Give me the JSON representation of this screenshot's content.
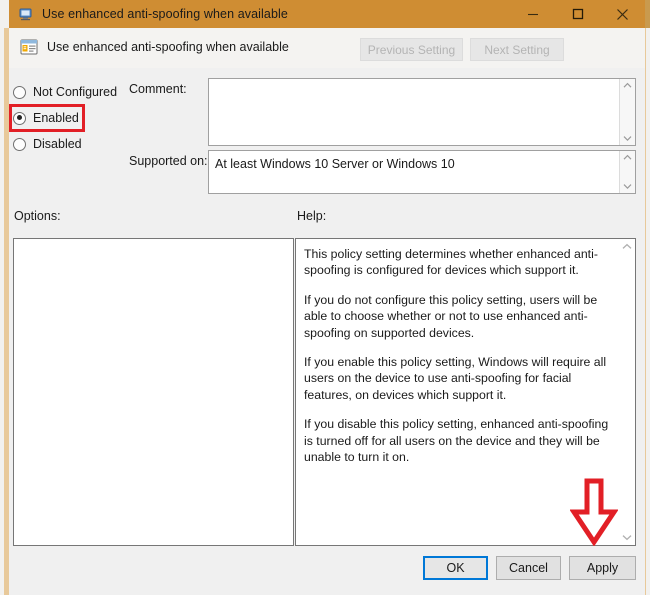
{
  "window": {
    "title": "Use enhanced anti-spoofing when available",
    "title_icon": "policy-window-icon",
    "minimize_icon": "minimize-icon",
    "maximize_icon": "maximize-icon",
    "close_icon": "close-icon",
    "titlebar_color": "#cf8d33"
  },
  "header": {
    "icon": "group-policy-setting-icon",
    "title": "Use enhanced anti-spoofing when available",
    "previous_setting_label": "Previous Setting",
    "next_setting_label": "Next Setting",
    "previous_setting_enabled": "false",
    "next_setting_enabled": "false"
  },
  "state_options": {
    "selected": "Enabled",
    "highlight_color": "#e21f26",
    "items": [
      {
        "label": "Not Configured",
        "selected": false
      },
      {
        "label": "Enabled",
        "selected": true
      },
      {
        "label": "Disabled",
        "selected": false
      }
    ]
  },
  "fields": {
    "comment_label": "Comment:",
    "comment_value": "",
    "supported_label": "Supported on:",
    "supported_value": "At least Windows 10 Server or Windows 10"
  },
  "panels": {
    "options_label": "Options:",
    "options_content": "",
    "help_label": "Help:",
    "help_paragraphs": [
      "This policy setting determines whether enhanced anti-spoofing is configured for devices which support it.",
      "If you do not configure this policy setting, users will be able to choose whether or not to use enhanced anti-spoofing on supported devices.",
      "If you enable this policy setting, Windows will require all users on the device to use anti-spoofing for facial features, on devices which support it.",
      "If you disable this policy setting, enhanced anti-spoofing is turned off for all users on the device and they will be unable to turn it on."
    ]
  },
  "footer": {
    "ok_label": "OK",
    "cancel_label": "Cancel",
    "apply_label": "Apply",
    "focused_button": "OK",
    "focus_color": "#0078d7"
  },
  "annotation": {
    "arrow_icon": "red-down-arrow-icon",
    "arrow_color": "#e21f26",
    "points_to": "Apply"
  },
  "scrollbars": {
    "up_chevron": "▲",
    "down_chevron": "▼"
  }
}
